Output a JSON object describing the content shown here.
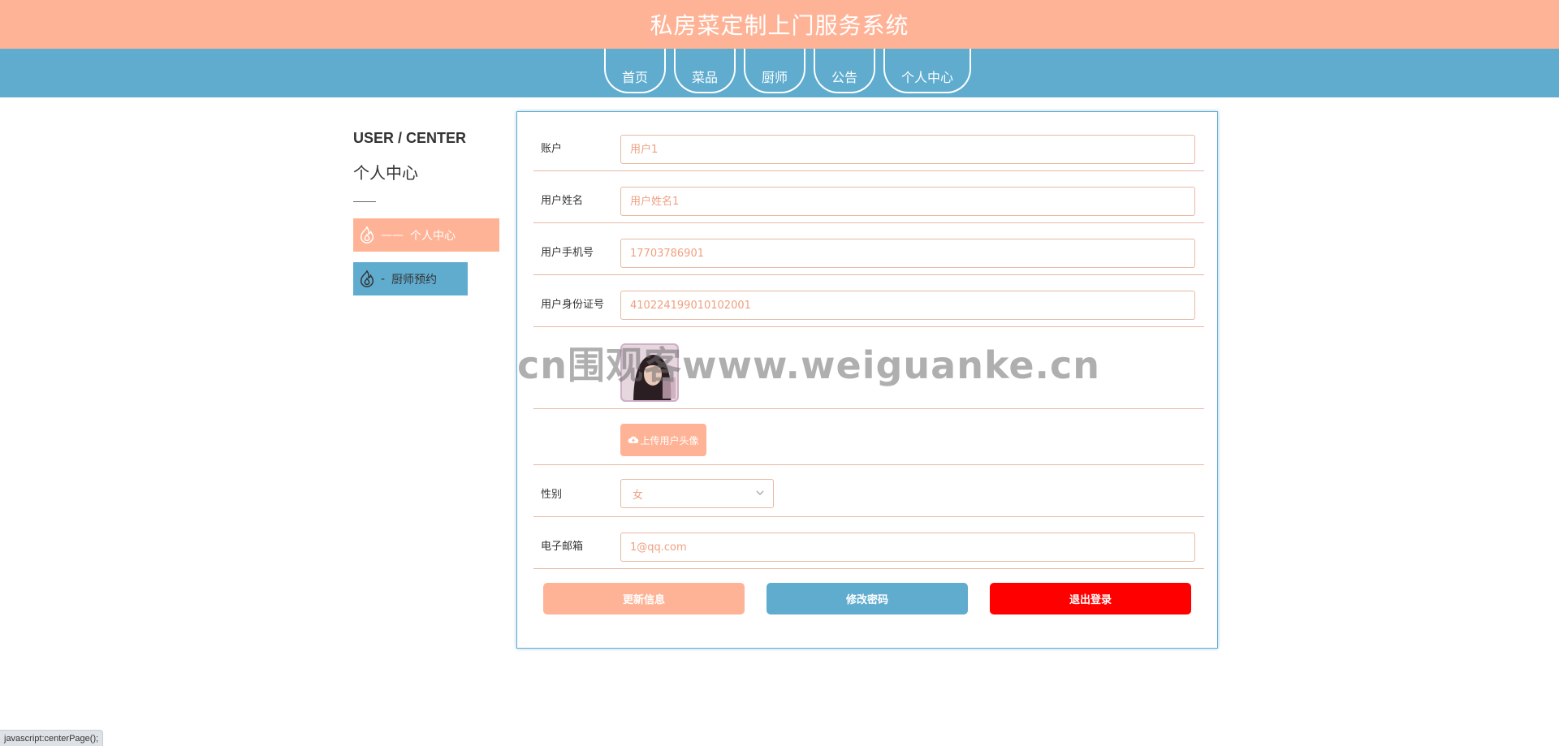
{
  "header": {
    "title": "私房菜定制上门服务系统"
  },
  "nav": {
    "items": [
      "首页",
      "菜品",
      "厨师",
      "公告",
      "个人中心"
    ]
  },
  "sidebar": {
    "en_title": "USER / CENTER",
    "cn_title": "个人中心",
    "items": [
      {
        "label": "个人中心",
        "prefix": "——",
        "icon": "flame-icon",
        "active": true
      },
      {
        "label": "厨师预约",
        "prefix": "-",
        "icon": "flame-icon",
        "active": false
      }
    ]
  },
  "form": {
    "account": {
      "label": "账户",
      "placeholder": "用户1"
    },
    "name": {
      "label": "用户姓名",
      "placeholder": "用户姓名1"
    },
    "phone": {
      "label": "用户手机号",
      "placeholder": "17703786901"
    },
    "idcard": {
      "label": "用户身份证号",
      "placeholder": "410224199010102001"
    },
    "upload_label": "上传用户头像",
    "gender": {
      "label": "性别",
      "value": "女"
    },
    "email": {
      "label": "电子邮箱",
      "placeholder": "1@qq.com"
    }
  },
  "buttons": {
    "update": "更新信息",
    "password": "修改密码",
    "logout": "退出登录"
  },
  "watermark": "cn围观客www.weiguanke.cn",
  "status_bar": "javascript:centerPage();",
  "colors": {
    "primary": "#ffb396",
    "secondary": "#5faccf",
    "danger": "#ff0000"
  }
}
